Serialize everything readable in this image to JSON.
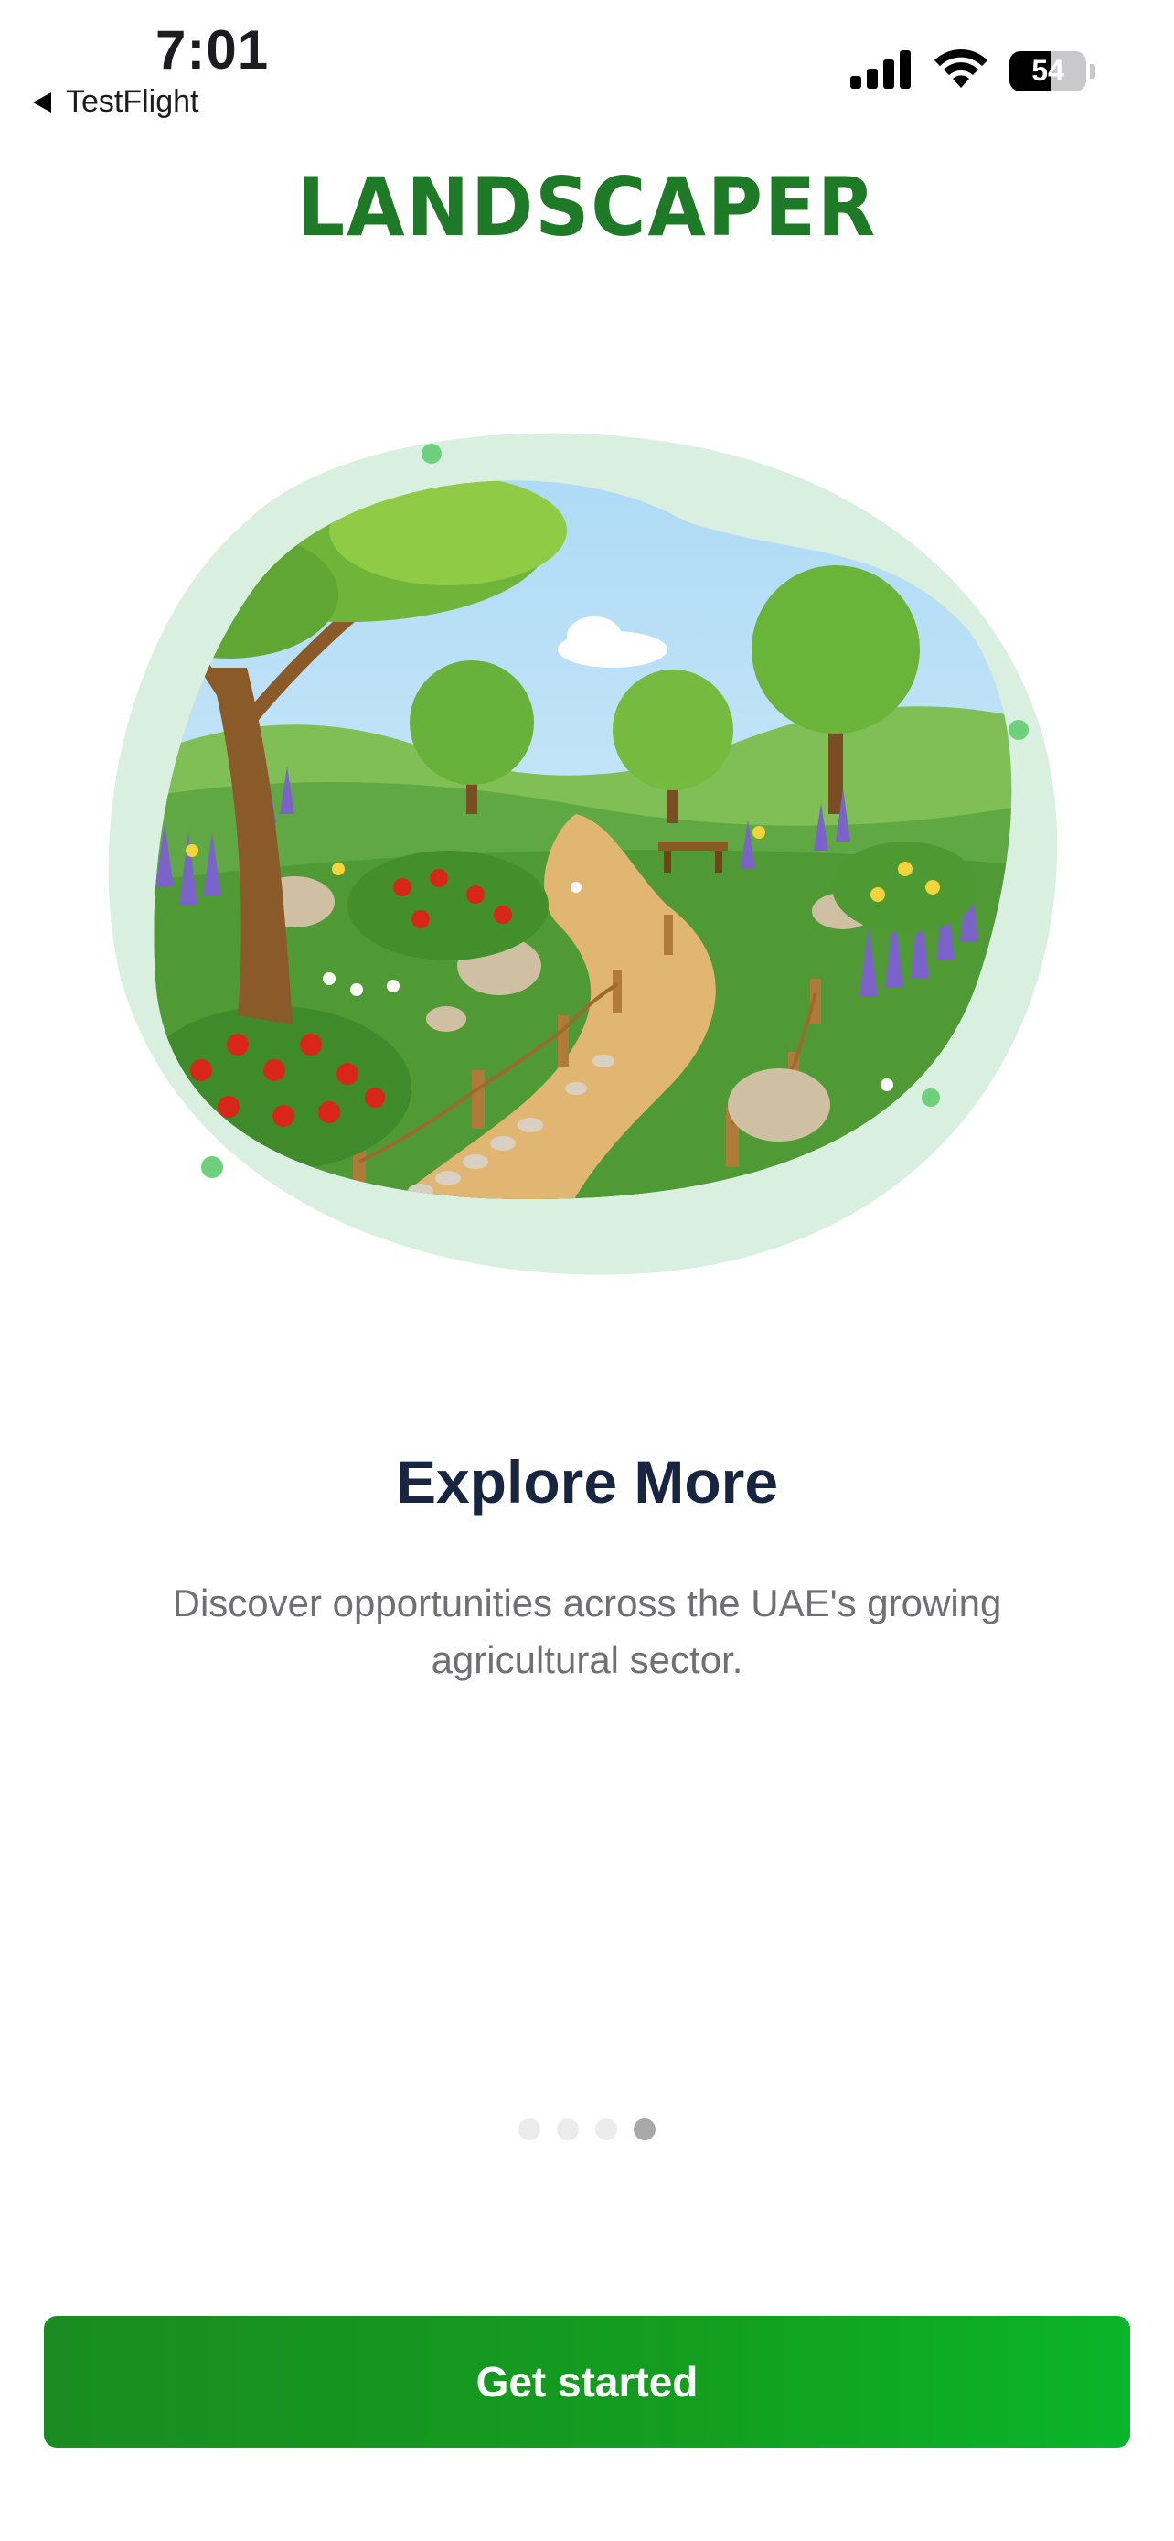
{
  "status_bar": {
    "time": "7:01",
    "back_label": "TestFlight",
    "battery": "54"
  },
  "brand": {
    "logo_text": "LANDSCAPER",
    "color": "#1f7a27"
  },
  "onboarding": {
    "title": "Explore More",
    "description": "Discover opportunities across the UAE's growing agricultural sector.",
    "pages_total": 4,
    "current_page": 4
  },
  "cta": {
    "label": "Get started",
    "color": "#139e20"
  },
  "icons": [
    "back-arrow-icon",
    "cellular-signal-icon",
    "wifi-icon",
    "battery-icon"
  ]
}
